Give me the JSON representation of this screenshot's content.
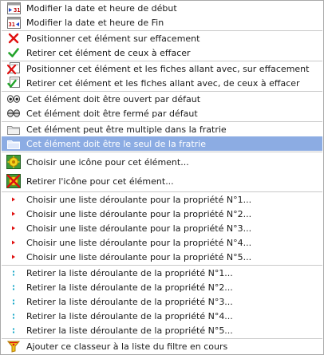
{
  "menu": {
    "items": [
      {
        "label": "Modifier la date et heure de début",
        "icon": "calendar-start-icon"
      },
      {
        "label": "Modifier la date et heure de Fin",
        "icon": "calendar-end-icon"
      },
      {
        "label": "Positionner cet élément sur effacement",
        "icon": "red-x-icon"
      },
      {
        "label": "Retirer cet élément de ceux à effacer",
        "icon": "green-check-icon"
      },
      {
        "label": "Positionner cet élément et les fiches allant avec, sur effacement",
        "icon": "doc-red-x-icon"
      },
      {
        "label": "Retirer cet élément et les fiches allant avec, de ceux à effacer",
        "icon": "doc-green-check-icon"
      },
      {
        "label": "Cet élément doit être ouvert par défaut",
        "icon": "eyes-open-icon"
      },
      {
        "label": "Cet élément doit être fermé  par défaut",
        "icon": "eyes-closed-icon"
      },
      {
        "label": "Cet élément peut être multiple dans la fratrie",
        "icon": "folder-icon"
      },
      {
        "label": "Cet élément doit être le seul de la fratrie",
        "icon": "folder-selected-icon"
      },
      {
        "label": "Choisir une icône pour cet élément...",
        "icon": "choose-icon-icon"
      },
      {
        "label": "Retirer l'icône pour cet élément...",
        "icon": "remove-icon-icon"
      },
      {
        "label": "Choisir une liste déroulante pour la propriété N°1...",
        "icon": "small-red-arrow-icon"
      },
      {
        "label": "Choisir une liste déroulante pour la propriété N°2...",
        "icon": "small-red-arrow-icon"
      },
      {
        "label": "Choisir une liste déroulante pour la propriété N°3...",
        "icon": "small-red-arrow-icon"
      },
      {
        "label": "Choisir une liste déroulante pour la propriété N°4...",
        "icon": "small-red-arrow-icon"
      },
      {
        "label": "Choisir une liste déroulante pour la propriété N°5...",
        "icon": "small-red-arrow-icon"
      },
      {
        "label": "Retirer la liste déroulante de la propriété N°1...",
        "icon": "small-cyan-dots-icon"
      },
      {
        "label": "Retirer la liste déroulante de la propriété N°2...",
        "icon": "small-cyan-dots-icon"
      },
      {
        "label": "Retirer la liste déroulante de la propriété N°3...",
        "icon": "small-cyan-dots-icon"
      },
      {
        "label": "Retirer la liste déroulante de la propriété N°4...",
        "icon": "small-cyan-dots-icon"
      },
      {
        "label": "Retirer la liste déroulante de la propriété N°5...",
        "icon": "small-cyan-dots-icon"
      },
      {
        "label": "Ajouter ce classeur à la liste du filtre en cours",
        "icon": "funnel-icon"
      }
    ],
    "highlighted_item": "Cet élément doit être le seul de la fratrie",
    "colors": {
      "highlight": "#8cace3",
      "separator": "#c9c9c9",
      "border": "#a9a9a9"
    }
  }
}
